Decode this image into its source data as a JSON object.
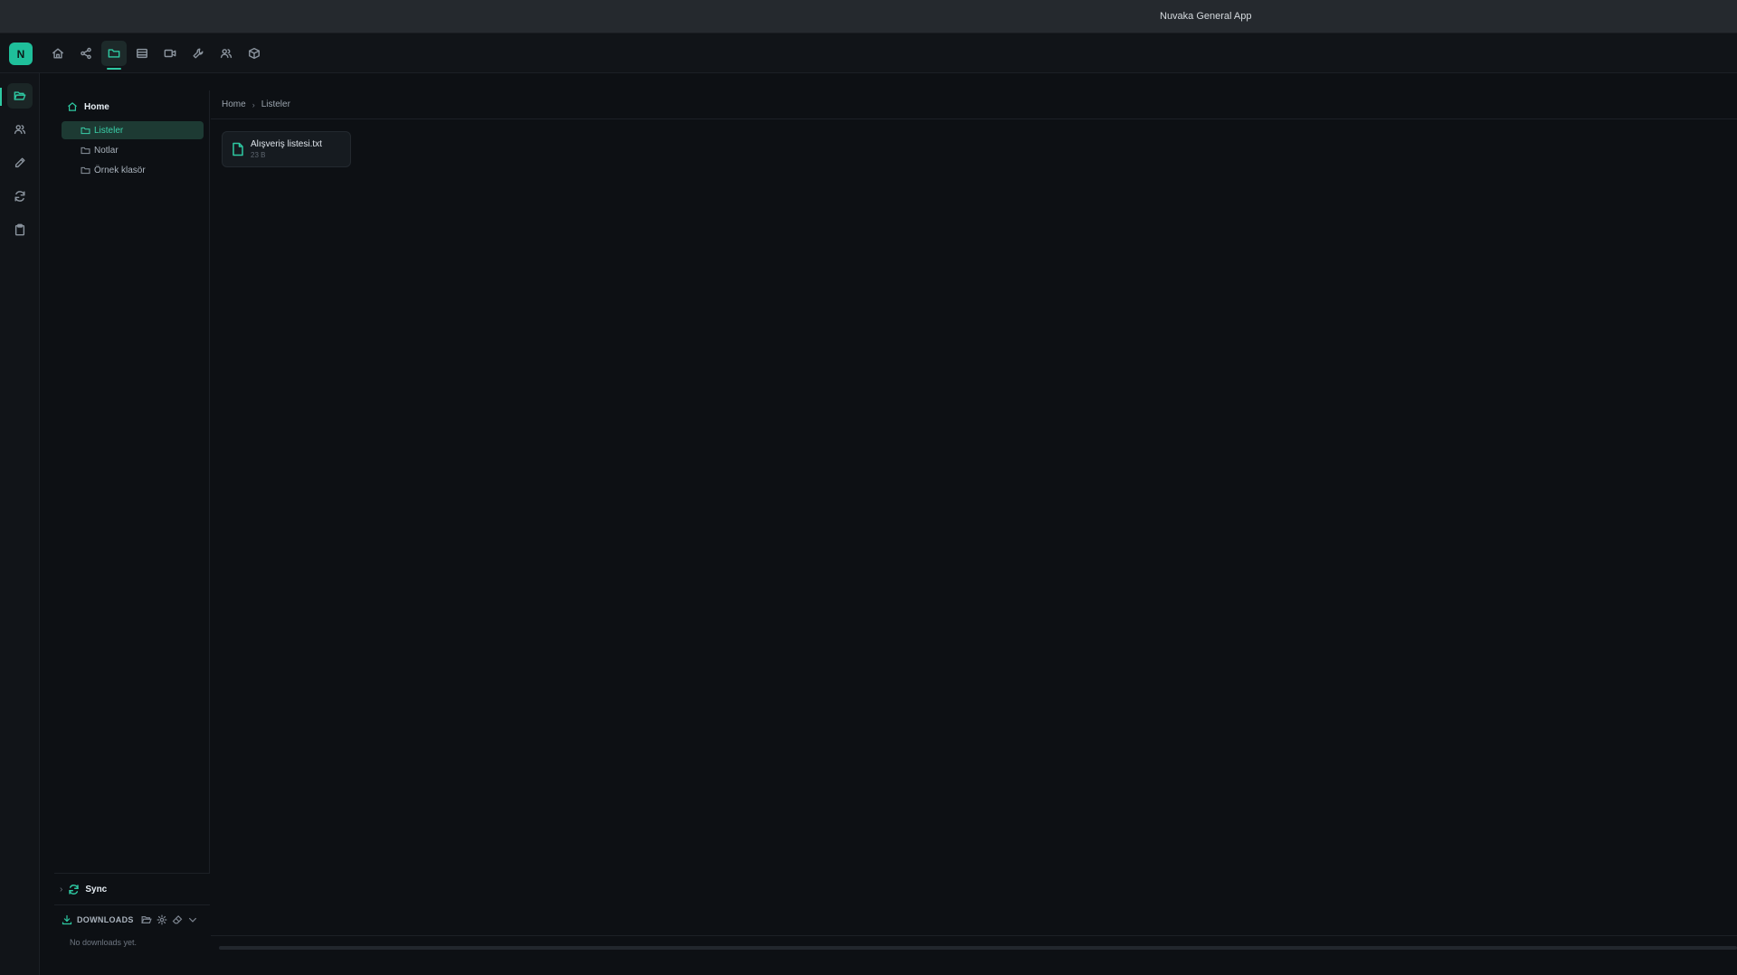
{
  "window": {
    "title": "Nuvaka General App"
  },
  "app": {
    "logo_letter": "N"
  },
  "topnav": [
    {
      "icon": "home-icon",
      "active": false
    },
    {
      "icon": "share-icon",
      "active": false
    },
    {
      "icon": "folder-icon",
      "active": true
    },
    {
      "icon": "table-icon",
      "active": false
    },
    {
      "icon": "video-icon",
      "active": false
    },
    {
      "icon": "wrench-icon",
      "active": false
    },
    {
      "icon": "users-icon",
      "active": false
    },
    {
      "icon": "box-icon",
      "active": false
    }
  ],
  "siderail": [
    {
      "icon": "folder-open-icon",
      "active": true
    },
    {
      "icon": "users-icon",
      "active": false
    },
    {
      "icon": "pencil-icon",
      "active": false
    },
    {
      "icon": "refresh-icon",
      "active": false
    },
    {
      "icon": "clipboard-icon",
      "active": false
    }
  ],
  "tree": {
    "root_label": "Home",
    "items": [
      {
        "label": "Listeler",
        "active": true
      },
      {
        "label": "Notlar",
        "active": false
      },
      {
        "label": "Örnek klasör",
        "active": false
      }
    ]
  },
  "sync": {
    "label": "Sync"
  },
  "downloads": {
    "label": "DOWNLOADS",
    "empty_text": "No downloads yet."
  },
  "breadcrumb": [
    "Home",
    "Listeler"
  ],
  "files": [
    {
      "name": "Alışveriş listesi.txt",
      "size": "23 B"
    }
  ],
  "colors": {
    "accent": "#2ec9a2",
    "background": "#0d1014",
    "panel": "#111418"
  }
}
